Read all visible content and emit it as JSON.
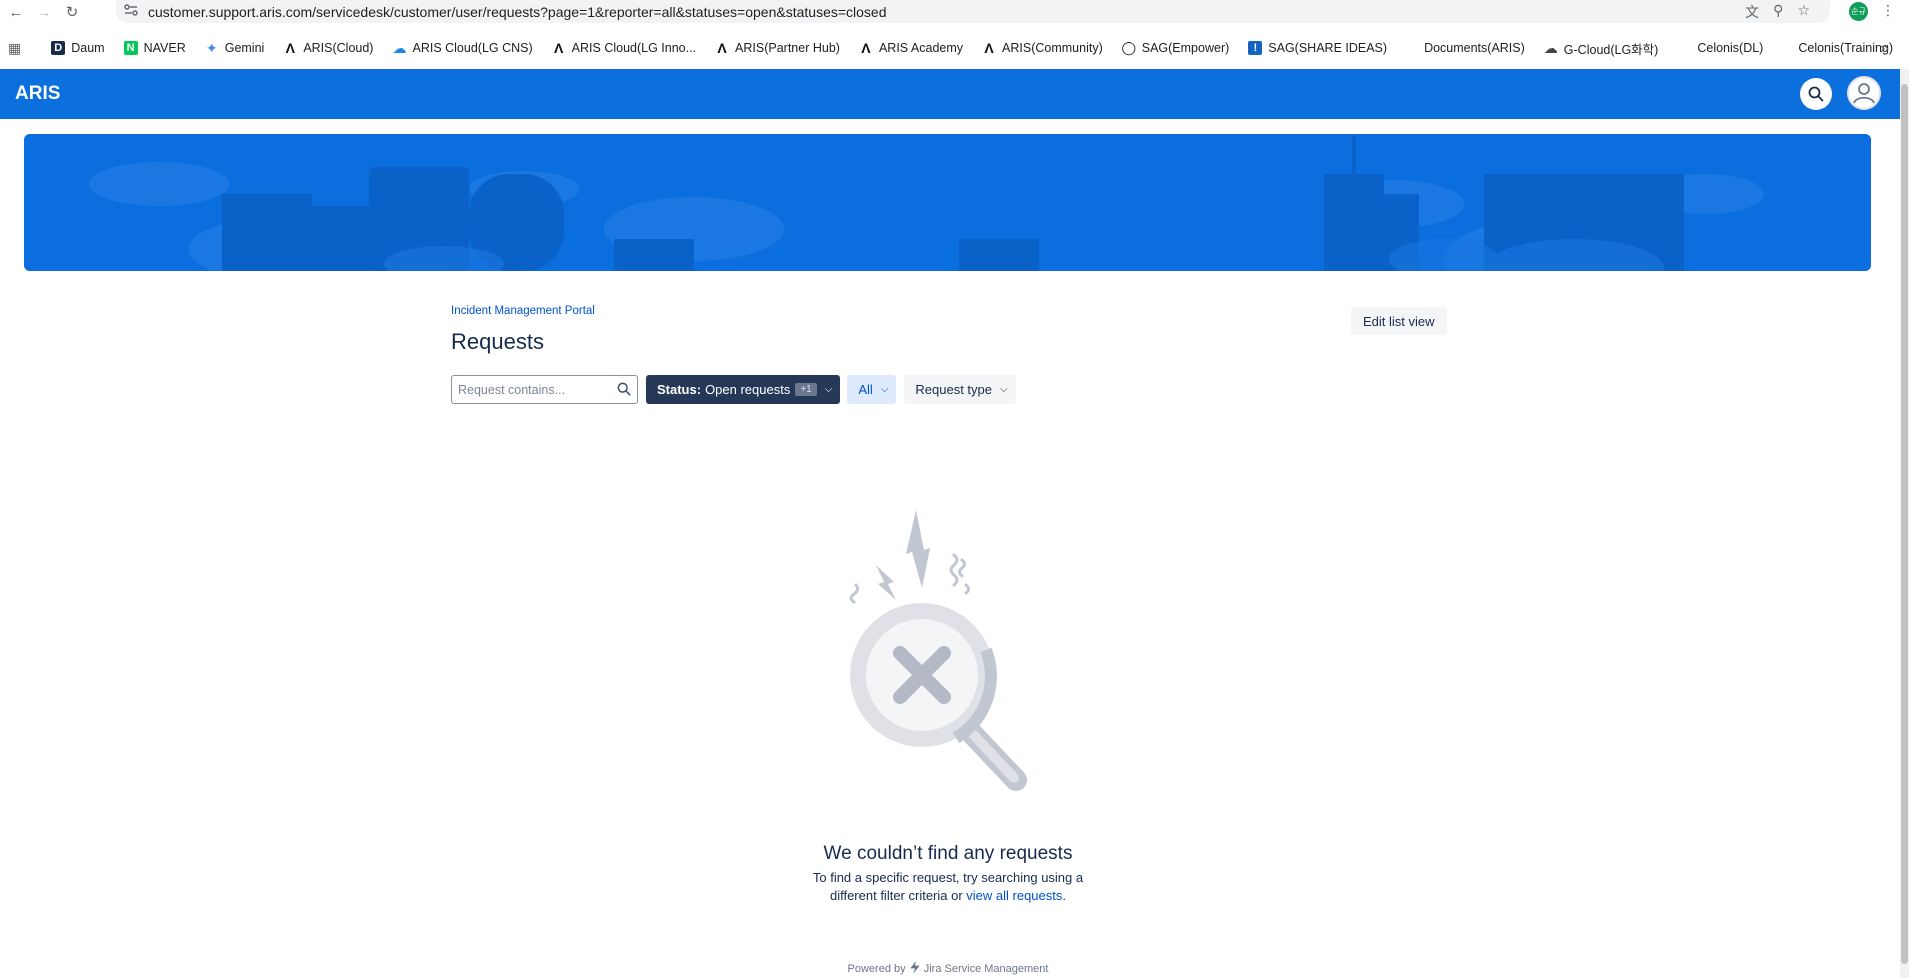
{
  "browser": {
    "url": "customer.support.aris.com/servicedesk/customer/user/requests?page=1&reporter=all&statuses=open&statuses=closed",
    "profile_initial": "순규"
  },
  "bookmarks": [
    {
      "label": "Daum",
      "icon": "daum-icon",
      "color": "#1a2a4a"
    },
    {
      "label": "NAVER",
      "icon": "naver-icon",
      "color": "#03c75a"
    },
    {
      "label": "Gemini",
      "icon": "gemini-icon",
      "color": "#4285f4"
    },
    {
      "label": "ARIS(Cloud)",
      "icon": "aris-icon",
      "color": "#111111"
    },
    {
      "label": "ARIS Cloud(LG CNS)",
      "icon": "cloud-icon",
      "color": "#1e88e5"
    },
    {
      "label": "ARIS Cloud(LG Inno...",
      "icon": "aris-icon",
      "color": "#111111"
    },
    {
      "label": "ARIS(Partner Hub)",
      "icon": "aris-icon",
      "color": "#111111"
    },
    {
      "label": "ARIS Academy",
      "icon": "aris-icon",
      "color": "#111111"
    },
    {
      "label": "ARIS(Community)",
      "icon": "aris-icon",
      "color": "#111111"
    },
    {
      "label": "SAG(Empower)",
      "icon": "empower-icon",
      "color": "#111111"
    },
    {
      "label": "SAG(SHARE IDEAS)",
      "icon": "share-ideas-icon",
      "color": "#1565c0"
    },
    {
      "label": "Documents(ARIS)",
      "icon": "",
      "color": ""
    },
    {
      "label": "G-Cloud(LG화학)",
      "icon": "cloud-outline-icon",
      "color": "#444444"
    },
    {
      "label": "Celonis(DL)",
      "icon": "",
      "color": ""
    },
    {
      "label": "Celonis(Training)",
      "icon": "",
      "color": ""
    }
  ],
  "header": {
    "logo": "ARIS",
    "brand_color": "#0c6fde"
  },
  "portal": {
    "breadcrumb": "Incident Management Portal",
    "title": "Requests",
    "edit_list_view": "Edit list view"
  },
  "filters": {
    "search_placeholder": "Request contains...",
    "status_label": "Status:",
    "status_value": "Open requests",
    "status_count": "+1",
    "reporter": "All",
    "request_type": "Request type"
  },
  "empty_state": {
    "title": "We couldn’t find any requests",
    "description_before": "To find a specific request, try searching using a different filter criteria or ",
    "link": "view all requests",
    "description_after": "."
  },
  "footer": {
    "powered_by": "Powered by",
    "product": "Jira Service Management"
  }
}
